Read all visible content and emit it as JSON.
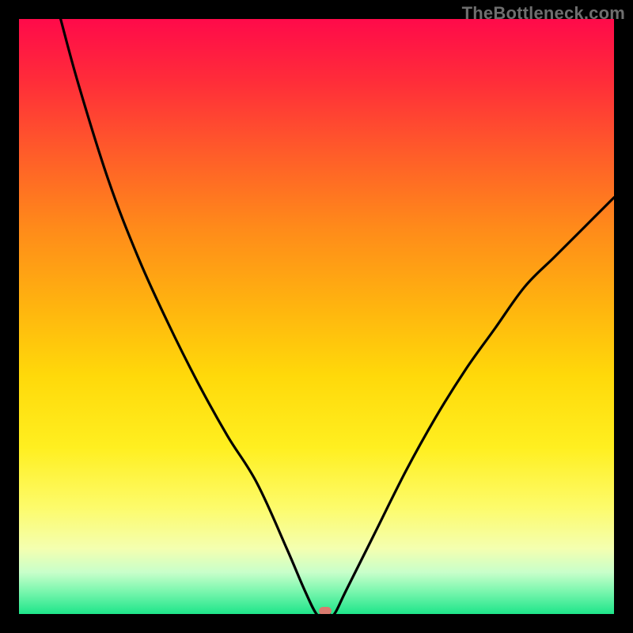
{
  "watermark": "TheBottleneck.com",
  "chart_data": {
    "type": "line",
    "title": "",
    "xlabel": "",
    "ylabel": "",
    "xlim": [
      0,
      100
    ],
    "ylim": [
      0,
      100
    ],
    "grid": false,
    "legend": false,
    "series": [
      {
        "name": "curve",
        "x": [
          7,
          10,
          15,
          20,
          25,
          30,
          35,
          40,
          45,
          48,
          50,
          51,
          52,
          53,
          55,
          60,
          65,
          70,
          75,
          80,
          85,
          90,
          95,
          100
        ],
        "y": [
          100,
          89,
          73,
          60,
          49,
          39,
          30,
          22,
          11,
          4,
          0,
          0,
          0,
          0,
          4,
          14,
          24,
          33,
          41,
          48,
          55,
          60,
          65,
          70
        ]
      }
    ],
    "marker": {
      "x": 51.5,
      "y": 0.5
    },
    "colors": {
      "curve": "#000000",
      "marker": "#d97a6f",
      "gradient_top": "#ff0a4a",
      "gradient_bottom": "#1ee58a"
    }
  }
}
